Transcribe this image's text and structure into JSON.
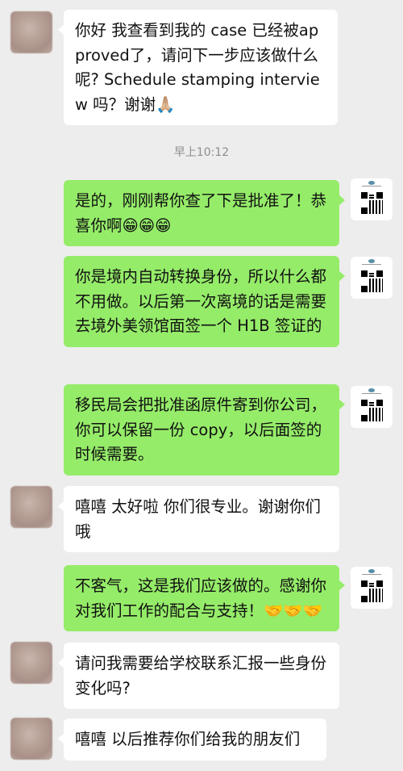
{
  "chat": {
    "timestamp": "早上10:12",
    "messages": [
      {
        "from": "contact",
        "text": "你好 我查看到我的 case 已经被approved了，请问下一步应该做什么呢? Schedule stamping interview 吗？谢谢🙏🏼"
      },
      {
        "from": "me",
        "text": "是的，刚刚帮你查了下是批准了！恭喜你啊😁😁😁"
      },
      {
        "from": "me",
        "text": "你是境内自动转换身份，所以什么都不用做。以后第一次离境的话是需要去境外美领馆面签一个 H1B 签证的"
      },
      {
        "from": "me",
        "text": "移民局会把批准函原件寄到你公司，你可以保留一份 copy，以后面签的时候需要。"
      },
      {
        "from": "contact",
        "text": "嘻嘻 太好啦 你们很专业。谢谢你们哦"
      },
      {
        "from": "me",
        "text": "不客气，这是我们应该做的。感谢你对我们工作的配合与支持！🤝🤝🤝"
      },
      {
        "from": "contact",
        "text": "请问我需要给学校联系汇报一些身份变化吗?"
      },
      {
        "from": "contact",
        "text": "嘻嘻 以后推荐你们给我的朋友们"
      }
    ]
  }
}
